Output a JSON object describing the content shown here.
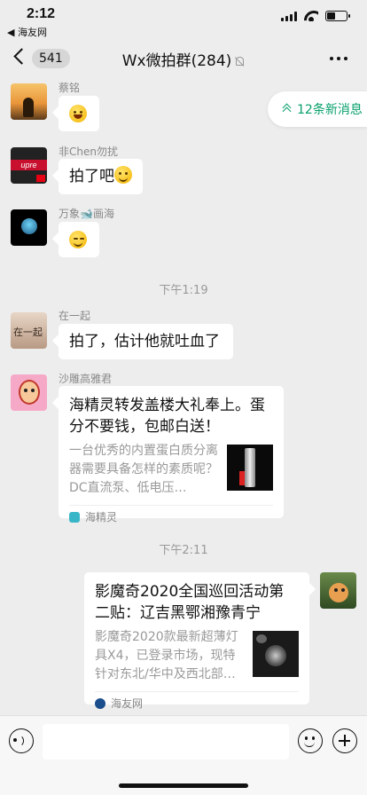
{
  "status_bar": {
    "time": "2:12",
    "back_app": "◀ 海友网",
    "battery_level": 0.45
  },
  "nav": {
    "unread_count": "541",
    "title": "Wx微拍群(284)"
  },
  "new_messages_label": "12条新消息",
  "messages": [
    {
      "sender": "蔡铭",
      "type": "emoji",
      "emoji": "laughing-emoji"
    },
    {
      "sender": "非Chen勿扰",
      "type": "text",
      "text": "拍了吧",
      "emoji": "grin-emoji"
    },
    {
      "sender": "万象🐋画海",
      "type": "emoji",
      "emoji": "smirk-emoji"
    },
    {
      "sender": "在一起",
      "type": "text",
      "text": "拍了，估计他就吐血了"
    },
    {
      "sender": "沙雕高雅君",
      "type": "link",
      "title": "海精灵转发盖楼大礼奉上。蛋分不要钱，包邮白送！",
      "desc": "一台优秀的内置蛋白质分离器需要具备怎样的素质呢？DC直流泵、低电压…",
      "source": "海精灵"
    },
    {
      "sender": "self",
      "type": "link",
      "title": "影魔奇2020全国巡回活动第二贴：辽吉黑鄂湘豫青宁",
      "desc": "影魔奇2020款最新超薄灯具X4，已登录市场，现特针对东北/华中及西北部…",
      "source": "海友网"
    }
  ],
  "time_labels": [
    "下午1:19",
    "下午2:11"
  ],
  "input_bar": {
    "placeholder": ""
  },
  "colors": {
    "accent_green": "#07a06a",
    "background": "#ededed"
  }
}
